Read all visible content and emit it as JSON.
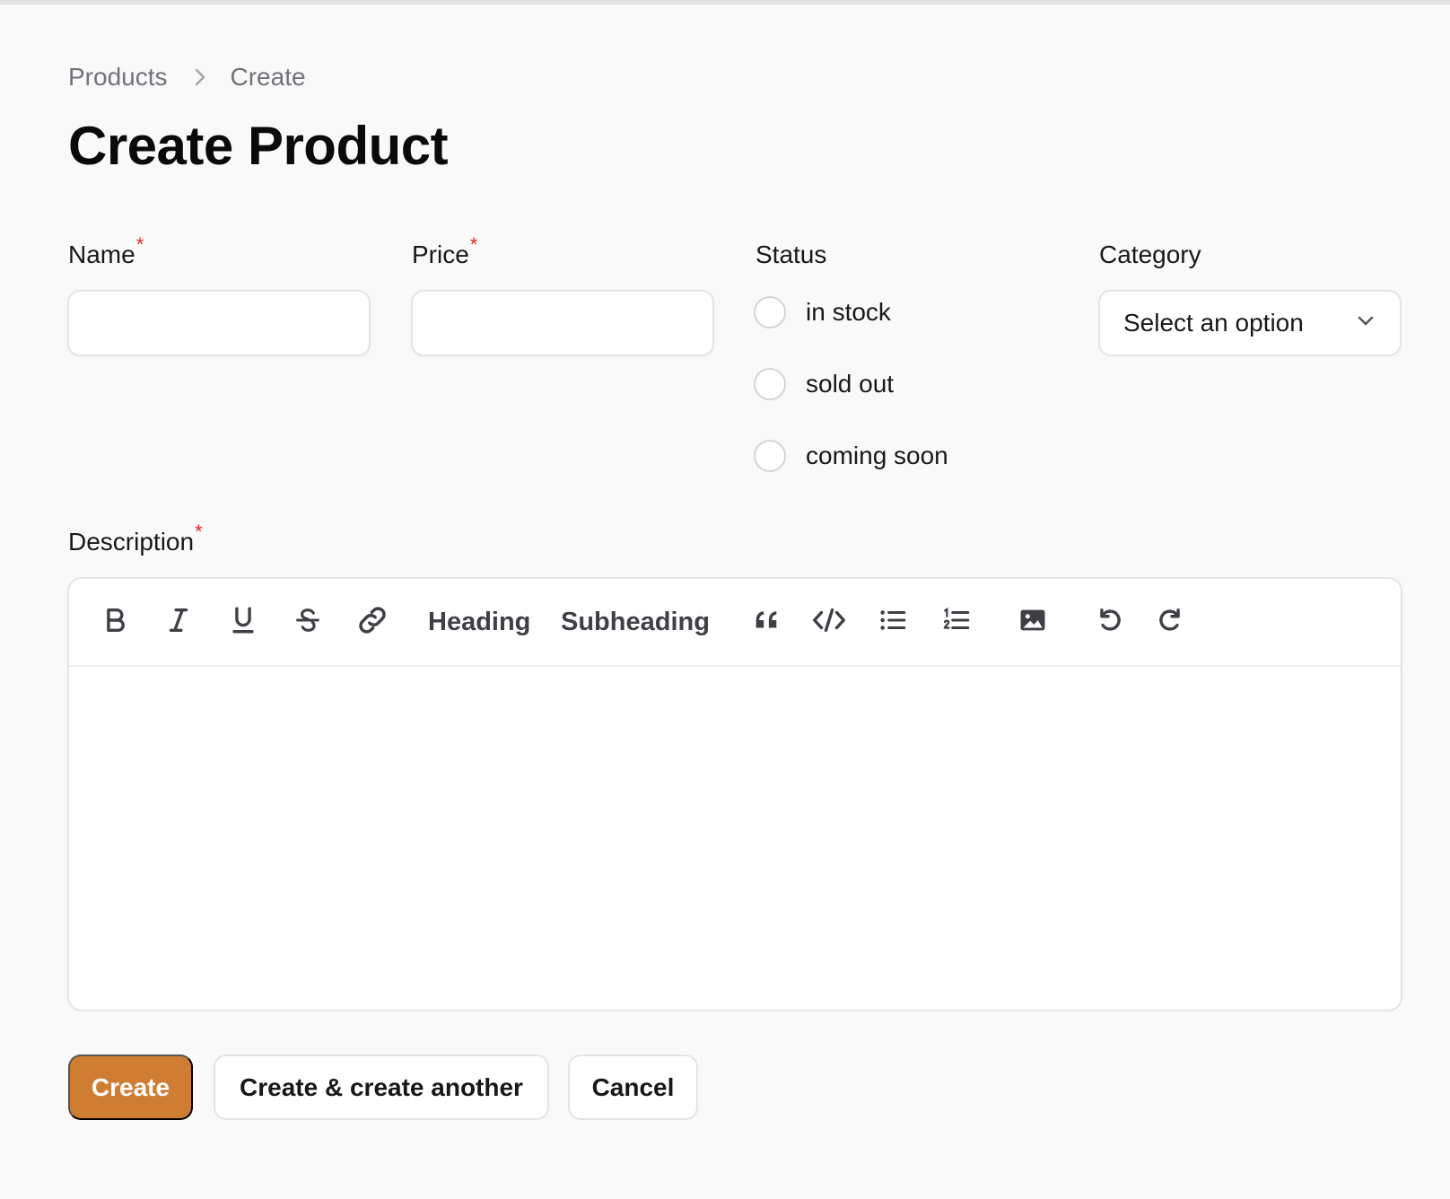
{
  "breadcrumb": {
    "items": [
      "Products",
      "Create"
    ]
  },
  "page": {
    "title": "Create Product"
  },
  "form": {
    "name": {
      "label": "Name",
      "required_mark": "*",
      "value": "",
      "placeholder": ""
    },
    "price": {
      "label": "Price",
      "required_mark": "*",
      "value": "",
      "placeholder": ""
    },
    "status": {
      "label": "Status",
      "options": [
        "in stock",
        "sold out",
        "coming soon"
      ],
      "selected": null
    },
    "category": {
      "label": "Category",
      "selected_text": "Select an option"
    },
    "description": {
      "label": "Description",
      "required_mark": "*",
      "toolbar": {
        "icons": [
          "bold-icon",
          "italic-icon",
          "underline-icon",
          "strikethrough-icon",
          "link-icon",
          "blockquote-icon",
          "code-icon",
          "bullet-list-icon",
          "ordered-list-icon",
          "image-icon",
          "undo-icon",
          "redo-icon"
        ],
        "heading_label": "Heading",
        "subheading_label": "Subheading"
      },
      "value": ""
    }
  },
  "actions": {
    "create_label": "Create",
    "create_another_label": "Create & create another",
    "cancel_label": "Cancel"
  },
  "colors": {
    "primary": "#d07d34",
    "required": "#dc2626",
    "border": "#e4e4e7",
    "background": "#f9f9f9"
  }
}
